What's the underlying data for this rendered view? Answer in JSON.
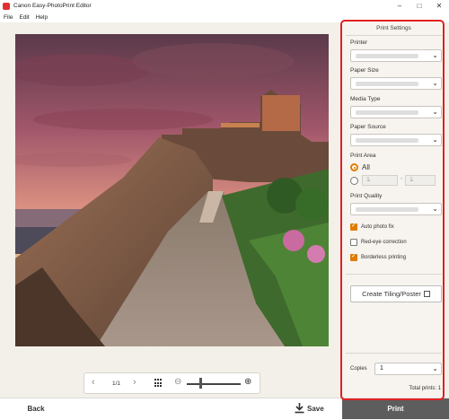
{
  "app": {
    "title": "Canon Easy-PhotoPrint Editor",
    "minimize": "–",
    "maximize": "□",
    "close": "✕"
  },
  "menu": [
    "File",
    "Edit",
    "Help"
  ],
  "nav": {
    "prev_icon": "‹",
    "next_icon": "›",
    "page_indicator": "1/1",
    "zoom_out_icon": "⊖",
    "zoom_in_icon": "⊕",
    "zoom_level": 0.25
  },
  "bottom": {
    "back_label": "Back",
    "save_label": "Save",
    "print_label": "Print"
  },
  "panel": {
    "title": "Print Settings",
    "printer_label": "Printer",
    "paper_size_label": "Paper Size",
    "media_type_label": "Media Type",
    "paper_source_label": "Paper Source",
    "print_area_label": "Print Area",
    "all_label": "All",
    "range_from": "1",
    "range_to": "1",
    "range_dash": "-",
    "print_quality_label": "Print Quality",
    "auto_photo_fix": {
      "label": "Auto photo fix",
      "checked": true
    },
    "red_eye": {
      "label": "Red-eye correction",
      "checked": false
    },
    "borderless": {
      "label": "Borderless printing",
      "checked": true
    },
    "tiling_label": "Create Tiling/Poster",
    "copies_label": "Copies",
    "copies_value": "1",
    "total_prints": "Total prints: 1"
  },
  "colors": {
    "accent": "#e07b00",
    "highlight": "#e02020",
    "print_button": "#5d5d5d"
  },
  "icons": {
    "chevron": "chevron-down-icon",
    "grid": "grid-view-icon",
    "save": "download-icon",
    "tiling": "copy-icon"
  }
}
